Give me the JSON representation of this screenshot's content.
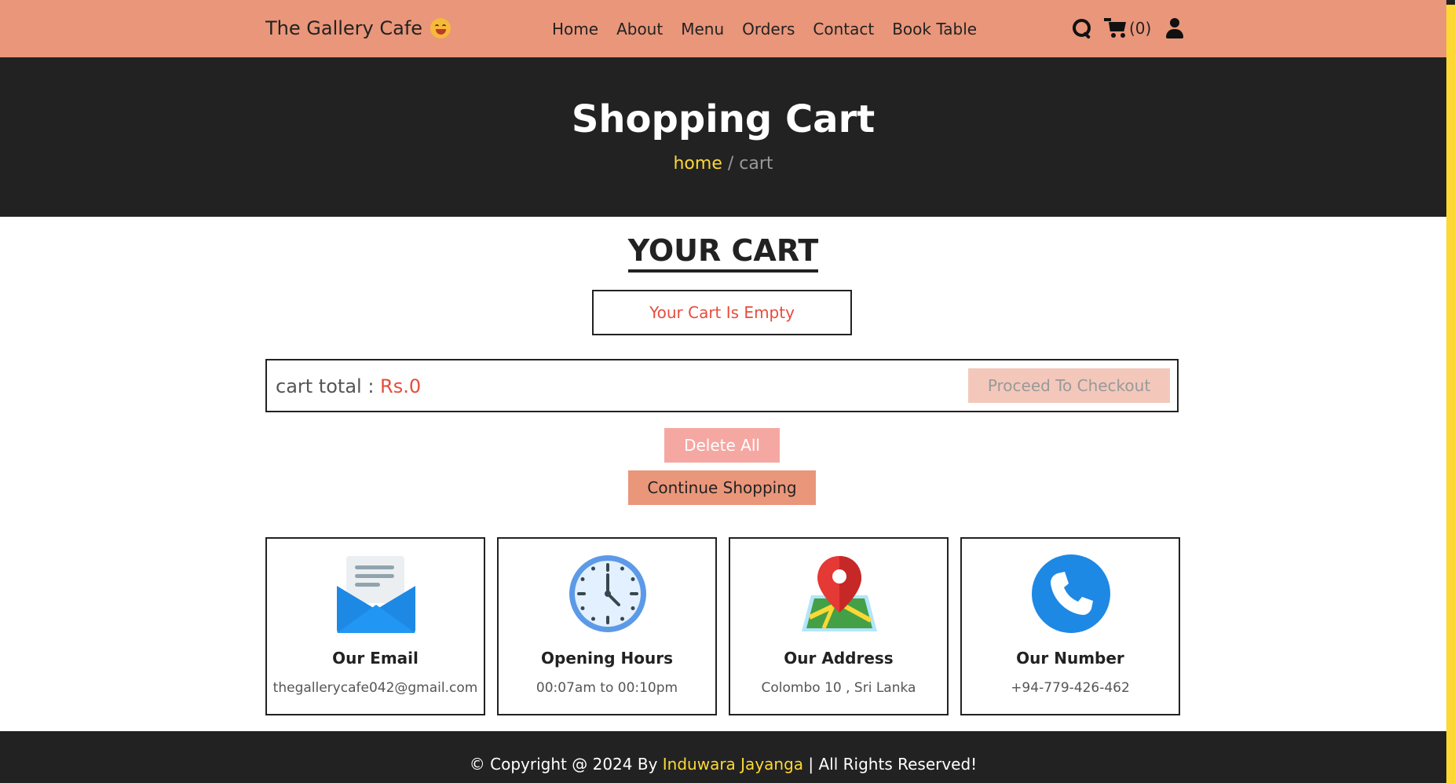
{
  "header": {
    "logo_text": "The Gallery Cafe",
    "nav": [
      "Home",
      "About",
      "Menu",
      "Orders",
      "Contact",
      "Book Table"
    ],
    "cart_count": "(0)"
  },
  "hero": {
    "title": "Shopping Cart",
    "breadcrumb_home": "home",
    "breadcrumb_sep": " / ",
    "breadcrumb_current": "cart"
  },
  "cart": {
    "heading": "YOUR CART",
    "empty_message": "Your Cart Is Empty",
    "total_label": "cart total : ",
    "total_amount": "Rs.0",
    "checkout_label": "Proceed To Checkout",
    "delete_all_label": "Delete All",
    "continue_label": "Continue Shopping"
  },
  "info_cards": [
    {
      "icon": "envelope-icon",
      "title": "Our Email",
      "value": "thegallerycafe042@gmail.com"
    },
    {
      "icon": "clock-icon",
      "title": "Opening Hours",
      "value": "00:07am to 00:10pm"
    },
    {
      "icon": "map-pin-icon",
      "title": "Our Address",
      "value": "Colombo 10 , Sri Lanka"
    },
    {
      "icon": "phone-icon",
      "title": "Our Number",
      "value": "+94-779-426-462"
    }
  ],
  "footer": {
    "prefix": "© Copyright @ 2024 By ",
    "author": "Induwara Jayanga",
    "suffix": " | All Rights Reserved!"
  },
  "colors": {
    "header_bg": "#ea967a",
    "dark_bg": "#222222",
    "accent_yellow": "#fdd835",
    "alert_red": "#e74c3c",
    "delete_btn": "#f5a7a2",
    "checkout_btn_disabled": "#f3c8bb"
  }
}
